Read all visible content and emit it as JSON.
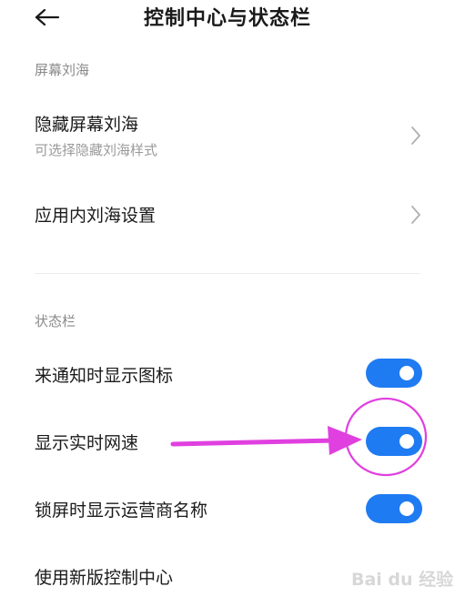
{
  "header": {
    "back_icon": "arrow-left-icon",
    "title": "控制中心与状态栏"
  },
  "sections": {
    "notch": {
      "title": "屏幕刘海",
      "items": [
        {
          "label": "隐藏屏幕刘海",
          "sublabel": "可选择隐藏刘海样式",
          "icon": "chevron-right-icon"
        },
        {
          "label": "应用内刘海设置",
          "icon": "chevron-right-icon"
        }
      ]
    },
    "status_bar": {
      "title": "状态栏",
      "items": [
        {
          "label": "来通知时显示图标",
          "enabled": true
        },
        {
          "label": "显示实时网速",
          "enabled": true
        },
        {
          "label": "锁屏时显示运营商名称",
          "enabled": true
        },
        {
          "label": "使用新版控制中心"
        }
      ]
    }
  },
  "annotation": {
    "arrow_color": "#e040e0",
    "circle_color": "#e040e0"
  },
  "colors": {
    "accent": "#1f7bf2",
    "section_title": "#8a8a8a"
  },
  "watermark": {
    "text": "Bai du 经验"
  }
}
